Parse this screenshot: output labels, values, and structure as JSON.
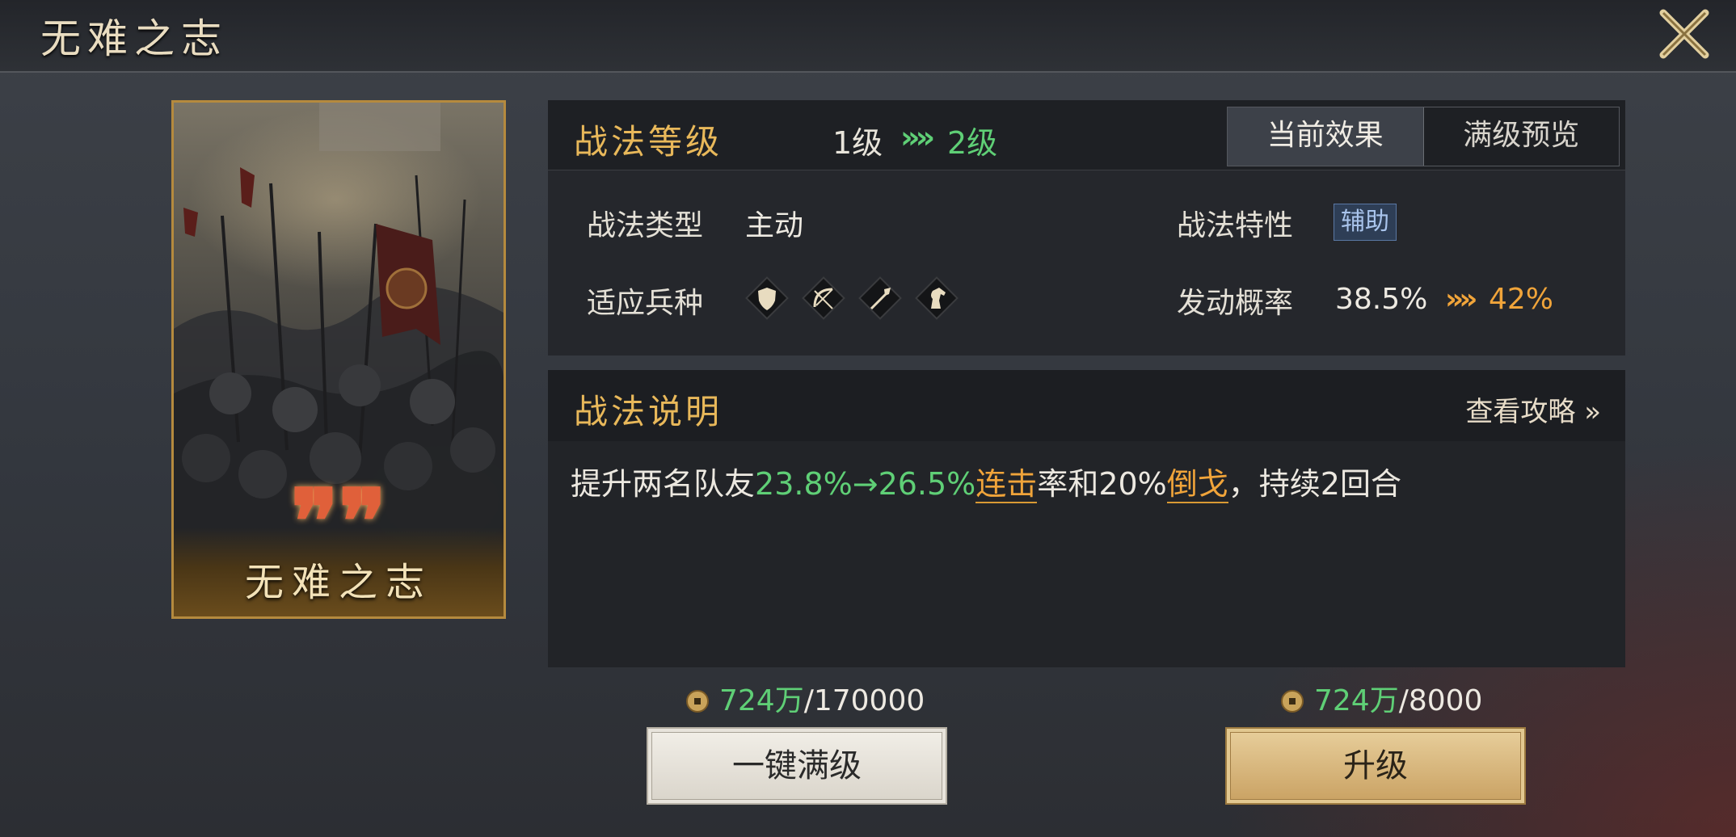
{
  "header": {
    "title": "无难之志"
  },
  "card": {
    "name": "无难之志",
    "quote_mark": "❞❞"
  },
  "level": {
    "label": "战法等级",
    "current": "1级",
    "arrow": "»",
    "next": "2级"
  },
  "tabs": [
    {
      "label": "当前效果",
      "active": true
    },
    {
      "label": "满级预览",
      "active": false
    }
  ],
  "info": {
    "type_label": "战法类型",
    "type_value": "主动",
    "trait_label": "战法特性",
    "trait_value": "辅助",
    "troops_label": "适应兵种",
    "troop_icons": [
      "shield-icon",
      "bow-icon",
      "spear-icon",
      "horse-icon"
    ],
    "rate_label": "发动概率",
    "rate_current": "38.5%",
    "rate_arrow": "»",
    "rate_next": "42%"
  },
  "description": {
    "label": "战法说明",
    "guide_link": "查看攻略 »",
    "text_1": "提升两名队友",
    "value_range": "23.8%→26.5%",
    "keyword_1": "连击",
    "text_2": "率和20%",
    "keyword_2": "倒戈",
    "text_3": "，持续2回合"
  },
  "costs": [
    {
      "have": "724万",
      "need": "/170000"
    },
    {
      "have": "724万",
      "need": "/8000"
    }
  ],
  "buttons": {
    "max_level": "一键满级",
    "upgrade": "升级"
  },
  "colors": {
    "gold": "#e8b85a",
    "green": "#5fcf76",
    "orange": "#f0a43a",
    "card_border": "#b58a3e"
  }
}
